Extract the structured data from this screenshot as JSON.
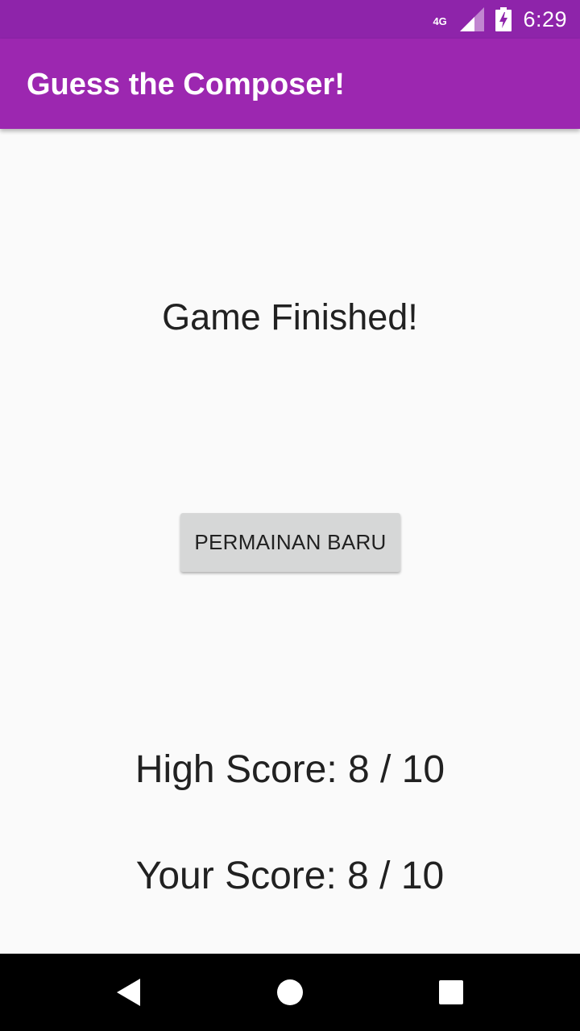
{
  "status_bar": {
    "network": "4G",
    "time": "6:29"
  },
  "app_bar": {
    "title": "Guess the Composer!"
  },
  "main": {
    "headline": "Game Finished!",
    "new_game_button": "PERMAINAN BARU",
    "high_score": "High Score: 8 / 10",
    "your_score": "Your Score: 8 / 10"
  },
  "nav_bar": {
    "icons": [
      "back-icon",
      "home-icon",
      "recents-icon"
    ]
  },
  "colors": {
    "status_bar": "#8e24aa",
    "app_bar": "#9c27b0",
    "background": "#fafafa",
    "button": "#d6d7d7",
    "text": "#212121"
  }
}
